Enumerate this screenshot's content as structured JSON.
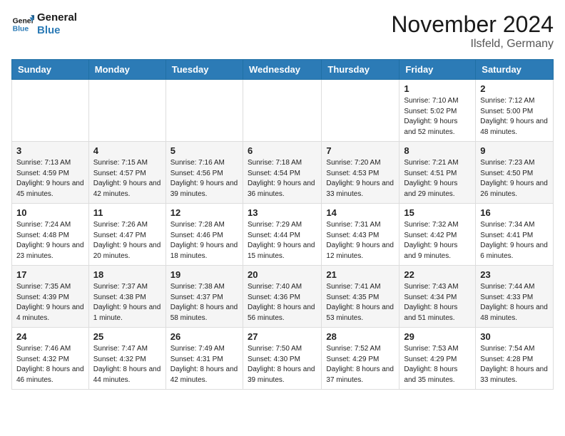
{
  "logo": {
    "line1": "General",
    "line2": "Blue"
  },
  "title": "November 2024",
  "location": "Ilsfeld, Germany",
  "weekdays": [
    "Sunday",
    "Monday",
    "Tuesday",
    "Wednesday",
    "Thursday",
    "Friday",
    "Saturday"
  ],
  "weeks": [
    [
      {
        "day": "",
        "info": ""
      },
      {
        "day": "",
        "info": ""
      },
      {
        "day": "",
        "info": ""
      },
      {
        "day": "",
        "info": ""
      },
      {
        "day": "",
        "info": ""
      },
      {
        "day": "1",
        "info": "Sunrise: 7:10 AM\nSunset: 5:02 PM\nDaylight: 9 hours\nand 52 minutes."
      },
      {
        "day": "2",
        "info": "Sunrise: 7:12 AM\nSunset: 5:00 PM\nDaylight: 9 hours\nand 48 minutes."
      }
    ],
    [
      {
        "day": "3",
        "info": "Sunrise: 7:13 AM\nSunset: 4:59 PM\nDaylight: 9 hours\nand 45 minutes."
      },
      {
        "day": "4",
        "info": "Sunrise: 7:15 AM\nSunset: 4:57 PM\nDaylight: 9 hours\nand 42 minutes."
      },
      {
        "day": "5",
        "info": "Sunrise: 7:16 AM\nSunset: 4:56 PM\nDaylight: 9 hours\nand 39 minutes."
      },
      {
        "day": "6",
        "info": "Sunrise: 7:18 AM\nSunset: 4:54 PM\nDaylight: 9 hours\nand 36 minutes."
      },
      {
        "day": "7",
        "info": "Sunrise: 7:20 AM\nSunset: 4:53 PM\nDaylight: 9 hours\nand 33 minutes."
      },
      {
        "day": "8",
        "info": "Sunrise: 7:21 AM\nSunset: 4:51 PM\nDaylight: 9 hours\nand 29 minutes."
      },
      {
        "day": "9",
        "info": "Sunrise: 7:23 AM\nSunset: 4:50 PM\nDaylight: 9 hours\nand 26 minutes."
      }
    ],
    [
      {
        "day": "10",
        "info": "Sunrise: 7:24 AM\nSunset: 4:48 PM\nDaylight: 9 hours\nand 23 minutes."
      },
      {
        "day": "11",
        "info": "Sunrise: 7:26 AM\nSunset: 4:47 PM\nDaylight: 9 hours\nand 20 minutes."
      },
      {
        "day": "12",
        "info": "Sunrise: 7:28 AM\nSunset: 4:46 PM\nDaylight: 9 hours\nand 18 minutes."
      },
      {
        "day": "13",
        "info": "Sunrise: 7:29 AM\nSunset: 4:44 PM\nDaylight: 9 hours\nand 15 minutes."
      },
      {
        "day": "14",
        "info": "Sunrise: 7:31 AM\nSunset: 4:43 PM\nDaylight: 9 hours\nand 12 minutes."
      },
      {
        "day": "15",
        "info": "Sunrise: 7:32 AM\nSunset: 4:42 PM\nDaylight: 9 hours\nand 9 minutes."
      },
      {
        "day": "16",
        "info": "Sunrise: 7:34 AM\nSunset: 4:41 PM\nDaylight: 9 hours\nand 6 minutes."
      }
    ],
    [
      {
        "day": "17",
        "info": "Sunrise: 7:35 AM\nSunset: 4:39 PM\nDaylight: 9 hours\nand 4 minutes."
      },
      {
        "day": "18",
        "info": "Sunrise: 7:37 AM\nSunset: 4:38 PM\nDaylight: 9 hours\nand 1 minute."
      },
      {
        "day": "19",
        "info": "Sunrise: 7:38 AM\nSunset: 4:37 PM\nDaylight: 8 hours\nand 58 minutes."
      },
      {
        "day": "20",
        "info": "Sunrise: 7:40 AM\nSunset: 4:36 PM\nDaylight: 8 hours\nand 56 minutes."
      },
      {
        "day": "21",
        "info": "Sunrise: 7:41 AM\nSunset: 4:35 PM\nDaylight: 8 hours\nand 53 minutes."
      },
      {
        "day": "22",
        "info": "Sunrise: 7:43 AM\nSunset: 4:34 PM\nDaylight: 8 hours\nand 51 minutes."
      },
      {
        "day": "23",
        "info": "Sunrise: 7:44 AM\nSunset: 4:33 PM\nDaylight: 8 hours\nand 48 minutes."
      }
    ],
    [
      {
        "day": "24",
        "info": "Sunrise: 7:46 AM\nSunset: 4:32 PM\nDaylight: 8 hours\nand 46 minutes."
      },
      {
        "day": "25",
        "info": "Sunrise: 7:47 AM\nSunset: 4:32 PM\nDaylight: 8 hours\nand 44 minutes."
      },
      {
        "day": "26",
        "info": "Sunrise: 7:49 AM\nSunset: 4:31 PM\nDaylight: 8 hours\nand 42 minutes."
      },
      {
        "day": "27",
        "info": "Sunrise: 7:50 AM\nSunset: 4:30 PM\nDaylight: 8 hours\nand 39 minutes."
      },
      {
        "day": "28",
        "info": "Sunrise: 7:52 AM\nSunset: 4:29 PM\nDaylight: 8 hours\nand 37 minutes."
      },
      {
        "day": "29",
        "info": "Sunrise: 7:53 AM\nSunset: 4:29 PM\nDaylight: 8 hours\nand 35 minutes."
      },
      {
        "day": "30",
        "info": "Sunrise: 7:54 AM\nSunset: 4:28 PM\nDaylight: 8 hours\nand 33 minutes."
      }
    ]
  ]
}
